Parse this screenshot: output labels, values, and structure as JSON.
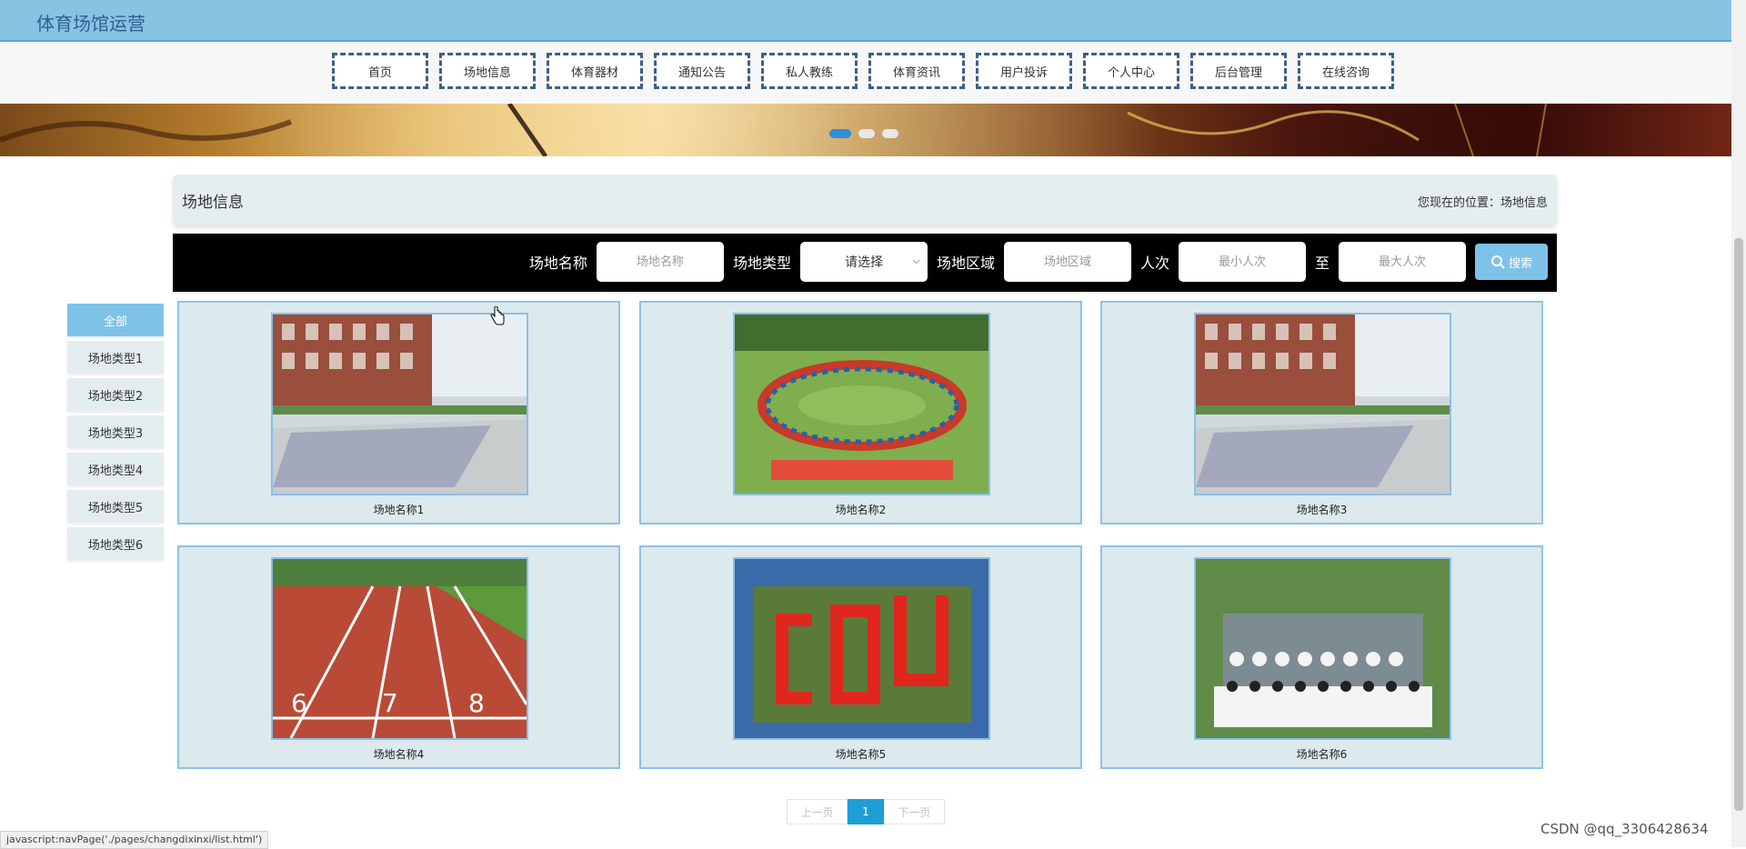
{
  "header": {
    "site_title": "体育场馆运营"
  },
  "nav": {
    "items": [
      "首页",
      "场地信息",
      "体育器材",
      "通知公告",
      "私人教练",
      "体育资讯",
      "用户投诉",
      "个人中心",
      "后台管理",
      "在线咨询"
    ]
  },
  "banner": {
    "dots": 3,
    "active_dot": 0
  },
  "panel": {
    "title": "场地信息",
    "breadcrumb": "您现在的位置：场地信息"
  },
  "search": {
    "name_label": "场地名称",
    "name_placeholder": "场地名称",
    "type_label": "场地类型",
    "type_value": "请选择",
    "area_label": "场地区域",
    "area_placeholder": "场地区域",
    "people_label": "人次",
    "min_placeholder": "最小人次",
    "to_label": "至",
    "max_placeholder": "最大人次",
    "button": "搜索"
  },
  "categories": [
    "全部",
    "场地类型1",
    "场地类型2",
    "场地类型3",
    "场地类型4",
    "场地类型5",
    "场地类型6"
  ],
  "cards": [
    {
      "name": "场地名称1",
      "image": "brick-building-court"
    },
    {
      "name": "场地名称2",
      "image": "circle-of-people-on-lawn"
    },
    {
      "name": "场地名称3",
      "image": "brick-building-court"
    },
    {
      "name": "场地名称4",
      "image": "running-track-lanes"
    },
    {
      "name": "场地名称5",
      "image": "aerial-red-letters-field"
    },
    {
      "name": "场地名称6",
      "image": "group-photo-bleachers"
    }
  ],
  "pagination": {
    "prev": "上一页",
    "current": "1",
    "next": "下一页"
  },
  "status_bar": "javascript:navPage('./pages/changdixinxi/list.html')",
  "watermark": "CSDN @qq_3306428634",
  "colors": {
    "header": "#87c3e3",
    "accent": "#7ec2e8",
    "nav_border": "#3b5f89",
    "page_current": "#1e9ed7"
  }
}
